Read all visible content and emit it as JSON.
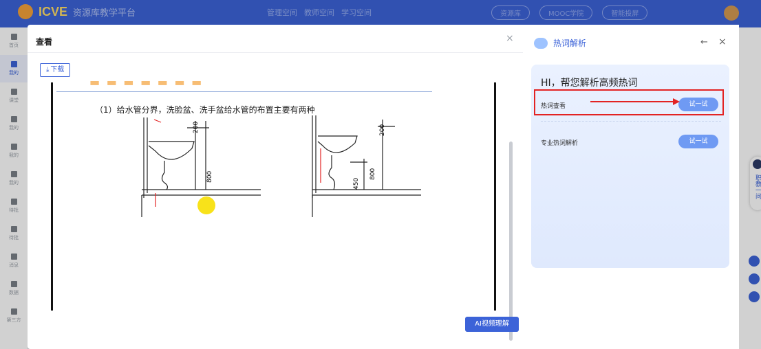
{
  "header": {
    "brand": "ICVE",
    "site_title": "资源库教学平台",
    "nav": [
      "管理空间",
      "教师空间",
      "学习空间"
    ],
    "pills": [
      "资源库",
      "MOOC学院",
      "智能投屏"
    ]
  },
  "sidebar": {
    "items": [
      {
        "label": "首页"
      },
      {
        "label": "我的"
      },
      {
        "label": "课堂"
      },
      {
        "label": "我的"
      },
      {
        "label": "我的"
      },
      {
        "label": "我的"
      },
      {
        "label": "待批"
      },
      {
        "label": "待批"
      },
      {
        "label": "消息"
      },
      {
        "label": "数据"
      },
      {
        "label": "第三方"
      }
    ]
  },
  "modal": {
    "title": "查看",
    "close_icon": "close-icon",
    "download_label": "下载",
    "document": {
      "caption": "（1）给水管分界，洗脸盆、洗手盆给水管的布置主要有两种",
      "figure_labels": [
        "200",
        "800",
        "200",
        "800",
        "450"
      ]
    },
    "ai_button_label": "AI视频理解"
  },
  "panel": {
    "title": "热词解析",
    "greeting": "HI，帮您解析高频热词",
    "rows": [
      {
        "label": "热词查看",
        "button": "试一试"
      },
      {
        "label": "专业热词解析",
        "button": "试一试"
      }
    ]
  },
  "right_strip": {
    "bot_text": "职教一问"
  },
  "colors": {
    "brand_blue": "#3c63d8",
    "highlight_red": "#e32323",
    "cursor_yellow": "#f8e21a"
  }
}
